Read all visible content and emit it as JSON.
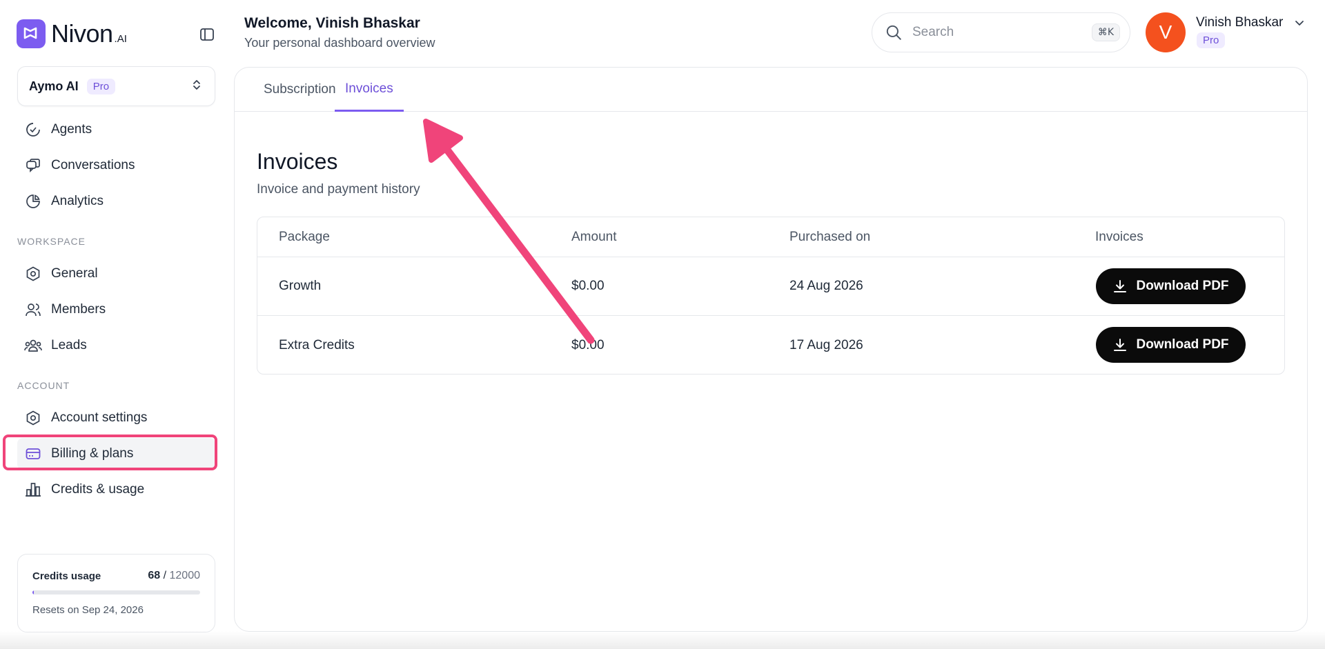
{
  "brand": {
    "name": "Nivon",
    "suffix": ".AI"
  },
  "workspace": {
    "name": "Aymo AI",
    "plan": "Pro"
  },
  "sidebar": {
    "main_items": [
      {
        "label": "Agents",
        "icon": "check-circle-icon"
      },
      {
        "label": "Conversations",
        "icon": "chat-bubbles-icon"
      },
      {
        "label": "Analytics",
        "icon": "pie-chart-icon"
      }
    ],
    "workspace_label": "WORKSPACE",
    "workspace_items": [
      {
        "label": "General",
        "icon": "settings-hex-icon"
      },
      {
        "label": "Members",
        "icon": "users-icon"
      },
      {
        "label": "Leads",
        "icon": "group-icon"
      }
    ],
    "account_label": "ACCOUNT",
    "account_items": [
      {
        "label": "Account settings",
        "icon": "settings-hex-icon"
      },
      {
        "label": "Billing & plans",
        "icon": "credit-card-icon"
      },
      {
        "label": "Credits & usage",
        "icon": "bar-chart-icon"
      }
    ]
  },
  "credits": {
    "title": "Credits usage",
    "used": "68",
    "separator": " / ",
    "total": "12000",
    "fraction_used": 0.0057,
    "reset_text": "Resets on Sep 24, 2026"
  },
  "header": {
    "welcome": "Welcome, Vinish Bhaskar",
    "subtitle": "Your personal dashboard overview",
    "search_placeholder": "Search",
    "search_shortcut": "⌘K"
  },
  "user": {
    "initial": "V",
    "name": "Vinish Bhaskar",
    "plan": "Pro"
  },
  "tabs": [
    {
      "label": "Subscription",
      "active": false
    },
    {
      "label": "Invoices",
      "active": true
    }
  ],
  "invoices": {
    "title": "Invoices",
    "subtitle": "Invoice and payment history",
    "columns": [
      "Package",
      "Amount",
      "Purchased on",
      "Invoices"
    ],
    "rows": [
      {
        "package": "Growth",
        "amount": "$0.00",
        "date": "24 Aug 2026",
        "action": "Download PDF"
      },
      {
        "package": "Extra Credits",
        "amount": "$0.00",
        "date": "17 Aug 2026",
        "action": "Download PDF"
      }
    ]
  },
  "colors": {
    "accent": "#7c5cf0",
    "annotation": "#f0447a",
    "avatar": "#f4511e"
  }
}
